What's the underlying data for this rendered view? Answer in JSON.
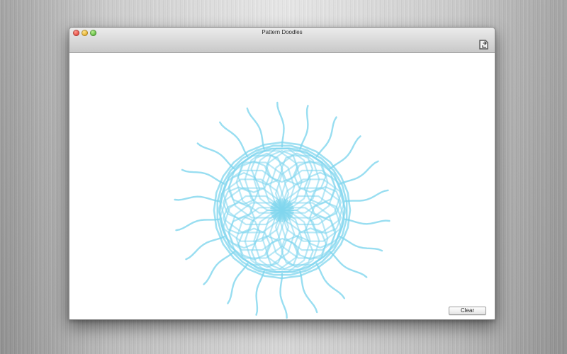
{
  "window": {
    "title": "Pattern Doodles"
  },
  "toolbar": {
    "export_icon": "export-icon"
  },
  "canvas": {
    "stroke_color": "#7fd6ee",
    "pattern": "radial-doodle"
  },
  "controls": {
    "clear_label": "Clear"
  },
  "colors": {
    "accent": "#7fd6ee",
    "close": "#e0443a",
    "minimize": "#e0a925",
    "zoom": "#57b33a"
  }
}
